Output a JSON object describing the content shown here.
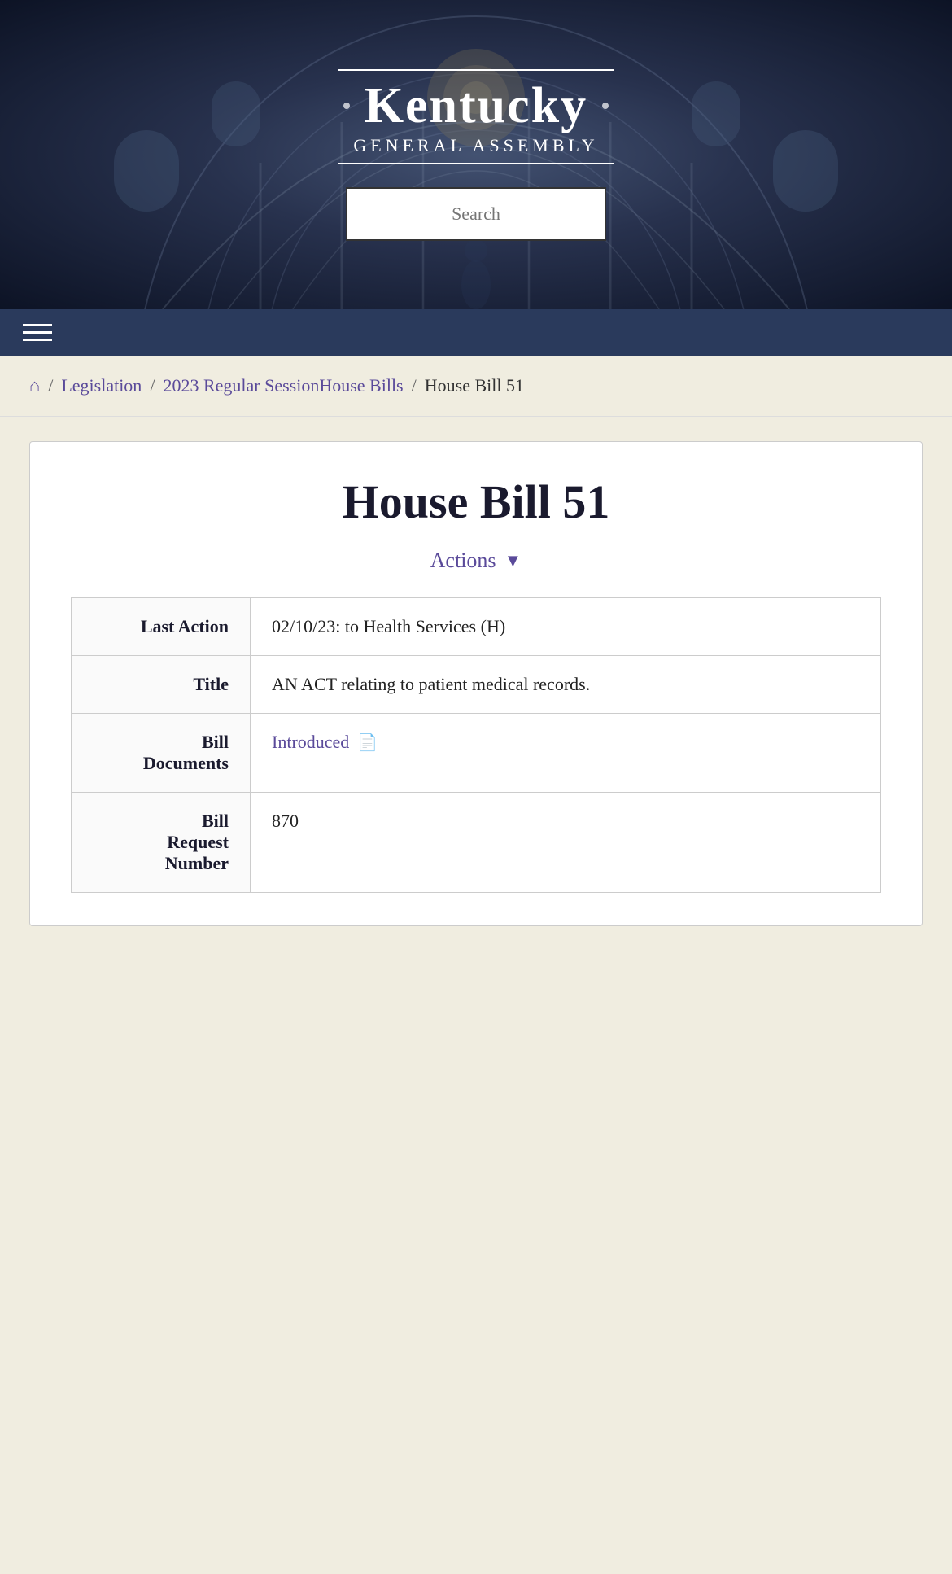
{
  "header": {
    "title": "Kentucky",
    "subtitle": "General Assembly",
    "search_placeholder": "Search"
  },
  "breadcrumb": {
    "home_label": "🏠",
    "items": [
      {
        "label": "Legislation",
        "href": "#"
      },
      {
        "label": "2023 Regular Session",
        "href": "#"
      },
      {
        "label": "House Bills",
        "href": "#"
      },
      {
        "label": "House Bill 51",
        "href": null
      }
    ],
    "separators": [
      "/",
      "/",
      "/",
      "/"
    ]
  },
  "bill": {
    "title": "House Bill 51",
    "actions_label": "Actions",
    "details": [
      {
        "label": "Last Action",
        "value": "02/10/23: to Health Services (H)",
        "type": "text"
      },
      {
        "label": "Title",
        "value": "AN ACT relating to patient medical records.",
        "type": "text"
      },
      {
        "label": "Bill Documents",
        "value": "Introduced",
        "type": "link"
      },
      {
        "label": "Bill Request Number",
        "value": "870",
        "type": "text"
      }
    ]
  },
  "colors": {
    "accent": "#5a4a9a",
    "header_bg": "#1a2340",
    "nav_bg": "#2a3a5c",
    "text_dark": "#1a1a2e"
  }
}
